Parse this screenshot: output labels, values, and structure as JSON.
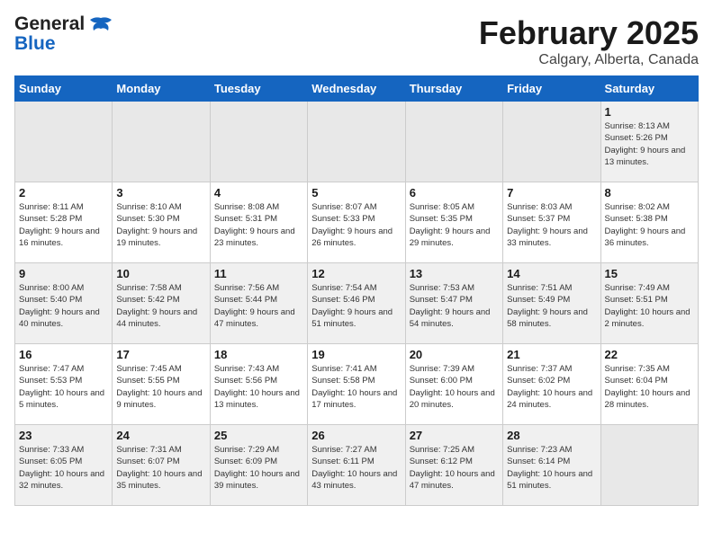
{
  "logo": {
    "text_general": "General",
    "text_blue": "Blue"
  },
  "header": {
    "month": "February 2025",
    "location": "Calgary, Alberta, Canada"
  },
  "weekdays": [
    "Sunday",
    "Monday",
    "Tuesday",
    "Wednesday",
    "Thursday",
    "Friday",
    "Saturday"
  ],
  "weeks": [
    [
      {
        "day": "",
        "info": ""
      },
      {
        "day": "",
        "info": ""
      },
      {
        "day": "",
        "info": ""
      },
      {
        "day": "",
        "info": ""
      },
      {
        "day": "",
        "info": ""
      },
      {
        "day": "",
        "info": ""
      },
      {
        "day": "1",
        "info": "Sunrise: 8:13 AM\nSunset: 5:26 PM\nDaylight: 9 hours and 13 minutes."
      }
    ],
    [
      {
        "day": "2",
        "info": "Sunrise: 8:11 AM\nSunset: 5:28 PM\nDaylight: 9 hours and 16 minutes."
      },
      {
        "day": "3",
        "info": "Sunrise: 8:10 AM\nSunset: 5:30 PM\nDaylight: 9 hours and 19 minutes."
      },
      {
        "day": "4",
        "info": "Sunrise: 8:08 AM\nSunset: 5:31 PM\nDaylight: 9 hours and 23 minutes."
      },
      {
        "day": "5",
        "info": "Sunrise: 8:07 AM\nSunset: 5:33 PM\nDaylight: 9 hours and 26 minutes."
      },
      {
        "day": "6",
        "info": "Sunrise: 8:05 AM\nSunset: 5:35 PM\nDaylight: 9 hours and 29 minutes."
      },
      {
        "day": "7",
        "info": "Sunrise: 8:03 AM\nSunset: 5:37 PM\nDaylight: 9 hours and 33 minutes."
      },
      {
        "day": "8",
        "info": "Sunrise: 8:02 AM\nSunset: 5:38 PM\nDaylight: 9 hours and 36 minutes."
      }
    ],
    [
      {
        "day": "9",
        "info": "Sunrise: 8:00 AM\nSunset: 5:40 PM\nDaylight: 9 hours and 40 minutes."
      },
      {
        "day": "10",
        "info": "Sunrise: 7:58 AM\nSunset: 5:42 PM\nDaylight: 9 hours and 44 minutes."
      },
      {
        "day": "11",
        "info": "Sunrise: 7:56 AM\nSunset: 5:44 PM\nDaylight: 9 hours and 47 minutes."
      },
      {
        "day": "12",
        "info": "Sunrise: 7:54 AM\nSunset: 5:46 PM\nDaylight: 9 hours and 51 minutes."
      },
      {
        "day": "13",
        "info": "Sunrise: 7:53 AM\nSunset: 5:47 PM\nDaylight: 9 hours and 54 minutes."
      },
      {
        "day": "14",
        "info": "Sunrise: 7:51 AM\nSunset: 5:49 PM\nDaylight: 9 hours and 58 minutes."
      },
      {
        "day": "15",
        "info": "Sunrise: 7:49 AM\nSunset: 5:51 PM\nDaylight: 10 hours and 2 minutes."
      }
    ],
    [
      {
        "day": "16",
        "info": "Sunrise: 7:47 AM\nSunset: 5:53 PM\nDaylight: 10 hours and 5 minutes."
      },
      {
        "day": "17",
        "info": "Sunrise: 7:45 AM\nSunset: 5:55 PM\nDaylight: 10 hours and 9 minutes."
      },
      {
        "day": "18",
        "info": "Sunrise: 7:43 AM\nSunset: 5:56 PM\nDaylight: 10 hours and 13 minutes."
      },
      {
        "day": "19",
        "info": "Sunrise: 7:41 AM\nSunset: 5:58 PM\nDaylight: 10 hours and 17 minutes."
      },
      {
        "day": "20",
        "info": "Sunrise: 7:39 AM\nSunset: 6:00 PM\nDaylight: 10 hours and 20 minutes."
      },
      {
        "day": "21",
        "info": "Sunrise: 7:37 AM\nSunset: 6:02 PM\nDaylight: 10 hours and 24 minutes."
      },
      {
        "day": "22",
        "info": "Sunrise: 7:35 AM\nSunset: 6:04 PM\nDaylight: 10 hours and 28 minutes."
      }
    ],
    [
      {
        "day": "23",
        "info": "Sunrise: 7:33 AM\nSunset: 6:05 PM\nDaylight: 10 hours and 32 minutes."
      },
      {
        "day": "24",
        "info": "Sunrise: 7:31 AM\nSunset: 6:07 PM\nDaylight: 10 hours and 35 minutes."
      },
      {
        "day": "25",
        "info": "Sunrise: 7:29 AM\nSunset: 6:09 PM\nDaylight: 10 hours and 39 minutes."
      },
      {
        "day": "26",
        "info": "Sunrise: 7:27 AM\nSunset: 6:11 PM\nDaylight: 10 hours and 43 minutes."
      },
      {
        "day": "27",
        "info": "Sunrise: 7:25 AM\nSunset: 6:12 PM\nDaylight: 10 hours and 47 minutes."
      },
      {
        "day": "28",
        "info": "Sunrise: 7:23 AM\nSunset: 6:14 PM\nDaylight: 10 hours and 51 minutes."
      },
      {
        "day": "",
        "info": ""
      }
    ]
  ]
}
